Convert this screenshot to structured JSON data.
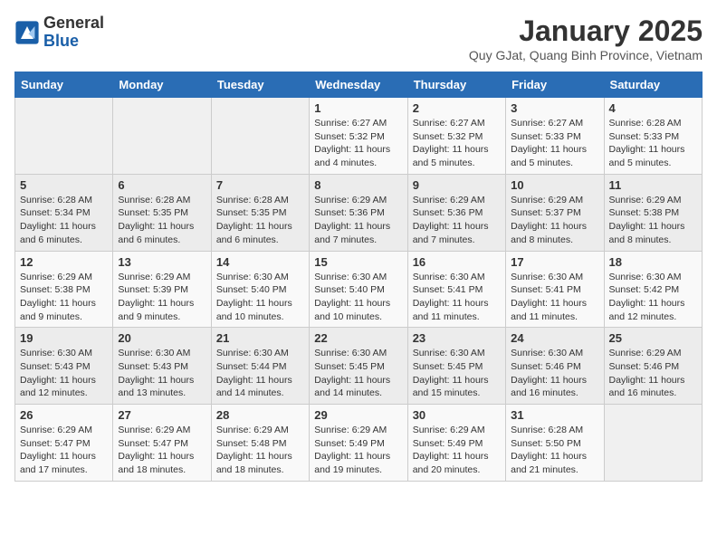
{
  "header": {
    "logo_general": "General",
    "logo_blue": "Blue",
    "month_title": "January 2025",
    "location": "Quy GJat, Quang Binh Province, Vietnam"
  },
  "weekdays": [
    "Sunday",
    "Monday",
    "Tuesday",
    "Wednesday",
    "Thursday",
    "Friday",
    "Saturday"
  ],
  "weeks": [
    [
      {
        "day": "",
        "info": ""
      },
      {
        "day": "",
        "info": ""
      },
      {
        "day": "",
        "info": ""
      },
      {
        "day": "1",
        "info": "Sunrise: 6:27 AM\nSunset: 5:32 PM\nDaylight: 11 hours and 4 minutes."
      },
      {
        "day": "2",
        "info": "Sunrise: 6:27 AM\nSunset: 5:32 PM\nDaylight: 11 hours and 5 minutes."
      },
      {
        "day": "3",
        "info": "Sunrise: 6:27 AM\nSunset: 5:33 PM\nDaylight: 11 hours and 5 minutes."
      },
      {
        "day": "4",
        "info": "Sunrise: 6:28 AM\nSunset: 5:33 PM\nDaylight: 11 hours and 5 minutes."
      }
    ],
    [
      {
        "day": "5",
        "info": "Sunrise: 6:28 AM\nSunset: 5:34 PM\nDaylight: 11 hours and 6 minutes."
      },
      {
        "day": "6",
        "info": "Sunrise: 6:28 AM\nSunset: 5:35 PM\nDaylight: 11 hours and 6 minutes."
      },
      {
        "day": "7",
        "info": "Sunrise: 6:28 AM\nSunset: 5:35 PM\nDaylight: 11 hours and 6 minutes."
      },
      {
        "day": "8",
        "info": "Sunrise: 6:29 AM\nSunset: 5:36 PM\nDaylight: 11 hours and 7 minutes."
      },
      {
        "day": "9",
        "info": "Sunrise: 6:29 AM\nSunset: 5:36 PM\nDaylight: 11 hours and 7 minutes."
      },
      {
        "day": "10",
        "info": "Sunrise: 6:29 AM\nSunset: 5:37 PM\nDaylight: 11 hours and 8 minutes."
      },
      {
        "day": "11",
        "info": "Sunrise: 6:29 AM\nSunset: 5:38 PM\nDaylight: 11 hours and 8 minutes."
      }
    ],
    [
      {
        "day": "12",
        "info": "Sunrise: 6:29 AM\nSunset: 5:38 PM\nDaylight: 11 hours and 9 minutes."
      },
      {
        "day": "13",
        "info": "Sunrise: 6:29 AM\nSunset: 5:39 PM\nDaylight: 11 hours and 9 minutes."
      },
      {
        "day": "14",
        "info": "Sunrise: 6:30 AM\nSunset: 5:40 PM\nDaylight: 11 hours and 10 minutes."
      },
      {
        "day": "15",
        "info": "Sunrise: 6:30 AM\nSunset: 5:40 PM\nDaylight: 11 hours and 10 minutes."
      },
      {
        "day": "16",
        "info": "Sunrise: 6:30 AM\nSunset: 5:41 PM\nDaylight: 11 hours and 11 minutes."
      },
      {
        "day": "17",
        "info": "Sunrise: 6:30 AM\nSunset: 5:41 PM\nDaylight: 11 hours and 11 minutes."
      },
      {
        "day": "18",
        "info": "Sunrise: 6:30 AM\nSunset: 5:42 PM\nDaylight: 11 hours and 12 minutes."
      }
    ],
    [
      {
        "day": "19",
        "info": "Sunrise: 6:30 AM\nSunset: 5:43 PM\nDaylight: 11 hours and 12 minutes."
      },
      {
        "day": "20",
        "info": "Sunrise: 6:30 AM\nSunset: 5:43 PM\nDaylight: 11 hours and 13 minutes."
      },
      {
        "day": "21",
        "info": "Sunrise: 6:30 AM\nSunset: 5:44 PM\nDaylight: 11 hours and 14 minutes."
      },
      {
        "day": "22",
        "info": "Sunrise: 6:30 AM\nSunset: 5:45 PM\nDaylight: 11 hours and 14 minutes."
      },
      {
        "day": "23",
        "info": "Sunrise: 6:30 AM\nSunset: 5:45 PM\nDaylight: 11 hours and 15 minutes."
      },
      {
        "day": "24",
        "info": "Sunrise: 6:30 AM\nSunset: 5:46 PM\nDaylight: 11 hours and 16 minutes."
      },
      {
        "day": "25",
        "info": "Sunrise: 6:29 AM\nSunset: 5:46 PM\nDaylight: 11 hours and 16 minutes."
      }
    ],
    [
      {
        "day": "26",
        "info": "Sunrise: 6:29 AM\nSunset: 5:47 PM\nDaylight: 11 hours and 17 minutes."
      },
      {
        "day": "27",
        "info": "Sunrise: 6:29 AM\nSunset: 5:47 PM\nDaylight: 11 hours and 18 minutes."
      },
      {
        "day": "28",
        "info": "Sunrise: 6:29 AM\nSunset: 5:48 PM\nDaylight: 11 hours and 18 minutes."
      },
      {
        "day": "29",
        "info": "Sunrise: 6:29 AM\nSunset: 5:49 PM\nDaylight: 11 hours and 19 minutes."
      },
      {
        "day": "30",
        "info": "Sunrise: 6:29 AM\nSunset: 5:49 PM\nDaylight: 11 hours and 20 minutes."
      },
      {
        "day": "31",
        "info": "Sunrise: 6:28 AM\nSunset: 5:50 PM\nDaylight: 11 hours and 21 minutes."
      },
      {
        "day": "",
        "info": ""
      }
    ]
  ]
}
